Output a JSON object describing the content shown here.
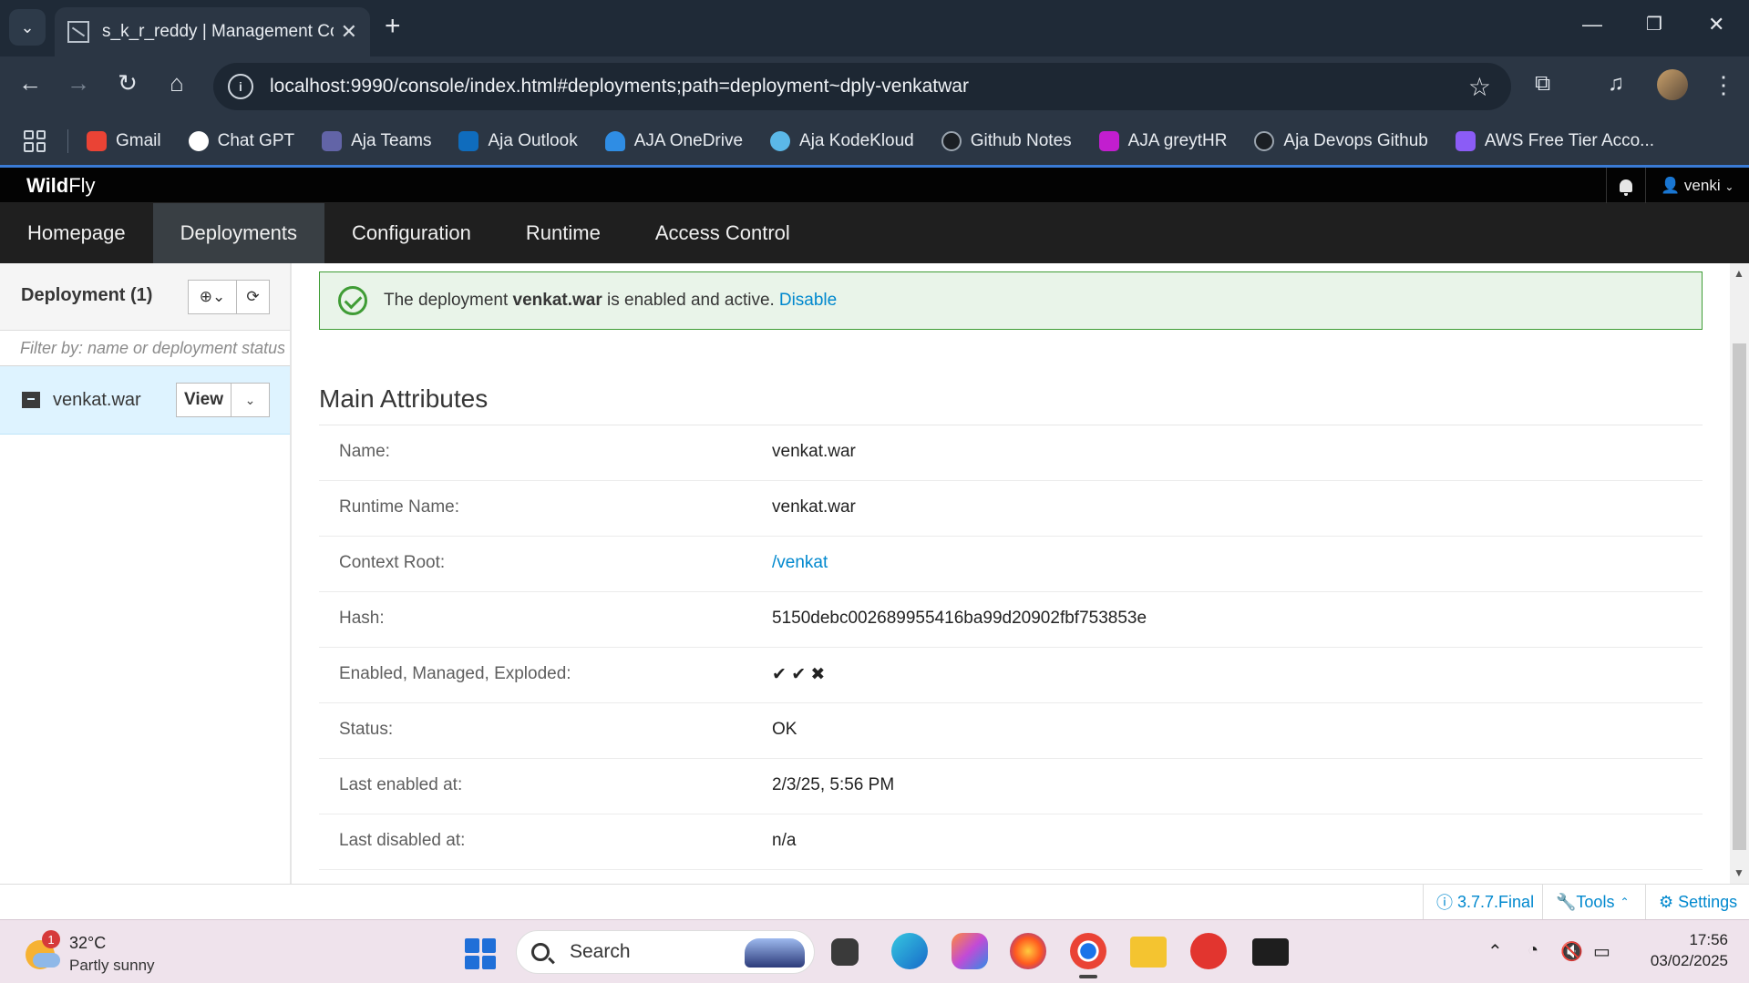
{
  "browser": {
    "tab_title": "s_k_r_reddy | Management Con",
    "url": "localhost:9990/console/index.html#deployments;path=deployment~dply-venkatwar",
    "bookmarks": [
      {
        "label": "Gmail",
        "icon": "gmail-icon",
        "color": "#ea4335"
      },
      {
        "label": "Chat GPT",
        "icon": "chatgpt-icon",
        "color": "#ffffff"
      },
      {
        "label": "Aja Teams",
        "icon": "teams-icon",
        "color": "#6264a7"
      },
      {
        "label": "Aja Outlook",
        "icon": "outlook-icon",
        "color": "#0f6cbd"
      },
      {
        "label": "AJA OneDrive",
        "icon": "onedrive-icon",
        "color": "#2f8de4"
      },
      {
        "label": "Aja KodeKloud",
        "icon": "kodekloud-icon",
        "color": "#5bb8e8"
      },
      {
        "label": "Github Notes",
        "icon": "github-icon",
        "color": "#1b1f24"
      },
      {
        "label": "AJA greytHR",
        "icon": "greythr-icon",
        "color": "#c21ecf"
      },
      {
        "label": "Aja Devops Github",
        "icon": "github-icon",
        "color": "#1b1f24"
      },
      {
        "label": "AWS Free Tier Acco...",
        "icon": "aws-icon",
        "color": "#8b5cf6"
      }
    ]
  },
  "console": {
    "logo_bold": "Wild",
    "logo_rest": "Fly",
    "user": "venki",
    "nav": [
      "Homepage",
      "Deployments",
      "Configuration",
      "Runtime",
      "Access Control"
    ],
    "active_nav": "Deployments"
  },
  "left_panel": {
    "title": "Deployment (1)",
    "filter_placeholder": "Filter by: name or deployment status",
    "item_name": "venkat.war",
    "view_label": "View"
  },
  "alert": {
    "prefix": "The deployment",
    "deployment": "venkat.war",
    "suffix": "is enabled and active.",
    "action": "Disable"
  },
  "attributes": {
    "title": "Main Attributes",
    "rows": [
      {
        "label": "Name:",
        "value": "venkat.war"
      },
      {
        "label": "Runtime Name:",
        "value": "venkat.war"
      },
      {
        "label": "Context Root:",
        "value": "/venkat"
      },
      {
        "label": "Hash:",
        "value": "5150debc002689955416ba99d20902fbf753853e"
      },
      {
        "label": "Enabled, Managed, Exploded:",
        "value": "✔ ✔ ✖"
      },
      {
        "label": "Status:",
        "value": "OK"
      },
      {
        "label": "Last enabled at:",
        "value": "2/3/25, 5:56 PM"
      },
      {
        "label": "Last disabled at:",
        "value": "n/a"
      }
    ]
  },
  "footer": {
    "version": "3.7.7.Final",
    "tools": "Tools",
    "settings": "Settings"
  },
  "taskbar": {
    "temperature": "32°C",
    "condition": "Partly sunny",
    "weather_badge": "1",
    "search_label": "Search",
    "time": "17:56",
    "date": "03/02/2025"
  }
}
